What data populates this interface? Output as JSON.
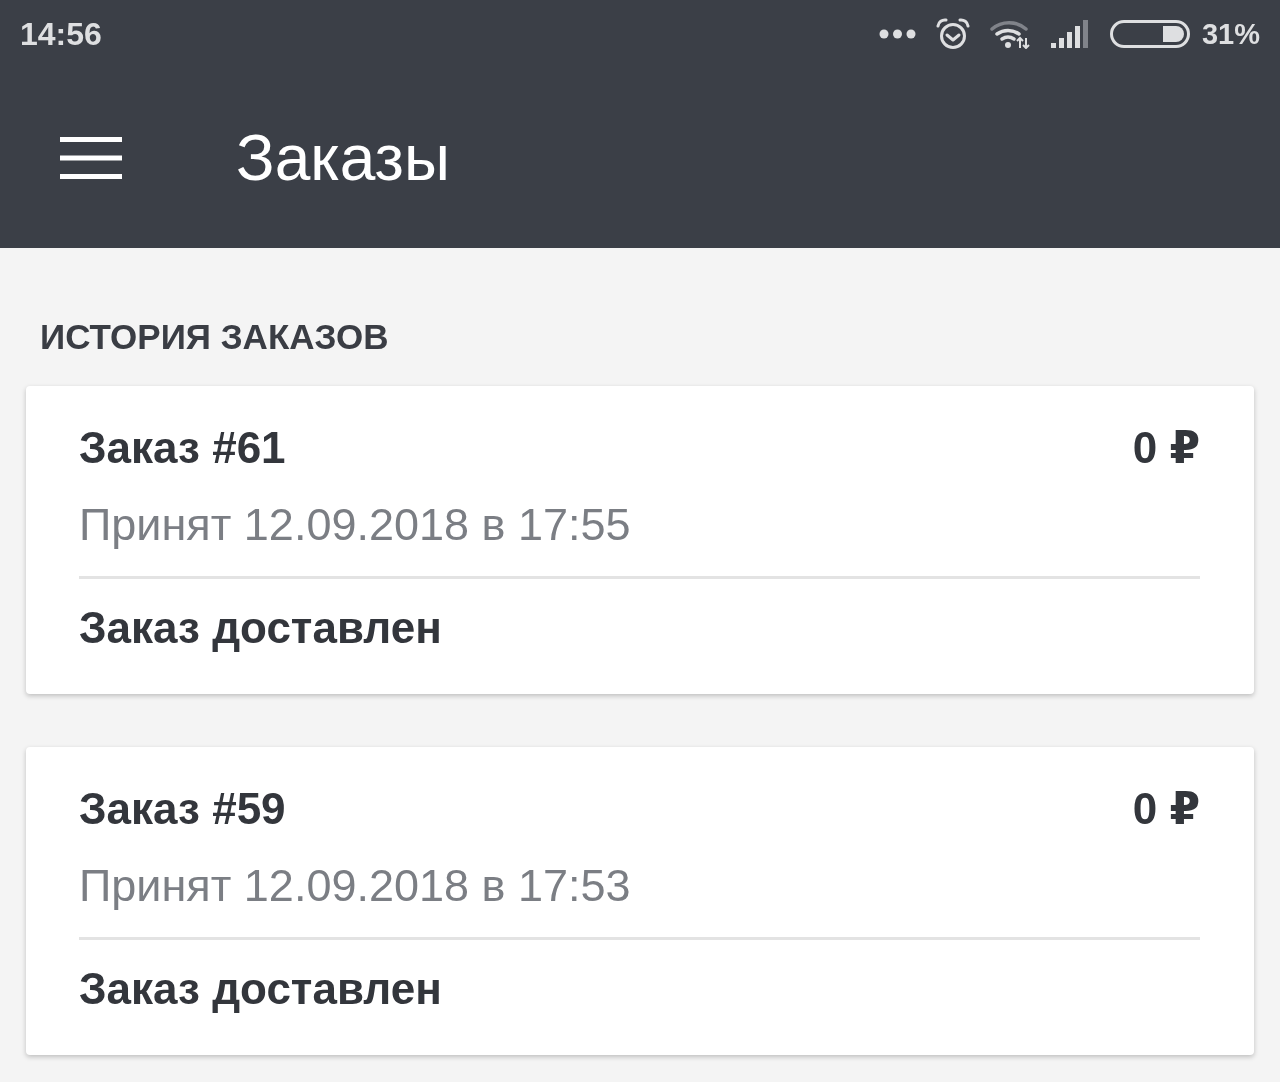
{
  "status_bar": {
    "time": "14:56",
    "battery_text": "31%"
  },
  "app_bar": {
    "title": "Заказы"
  },
  "section": {
    "title": "ИСТОРИЯ ЗАКАЗОВ"
  },
  "orders": [
    {
      "title": "Заказ #61",
      "price": "0 ₽",
      "accepted": "Принят 12.09.2018 в 17:55",
      "status": "Заказ доставлен"
    },
    {
      "title": "Заказ #59",
      "price": "0 ₽",
      "accepted": "Принят 12.09.2018 в 17:53",
      "status": "Заказ доставлен"
    }
  ]
}
